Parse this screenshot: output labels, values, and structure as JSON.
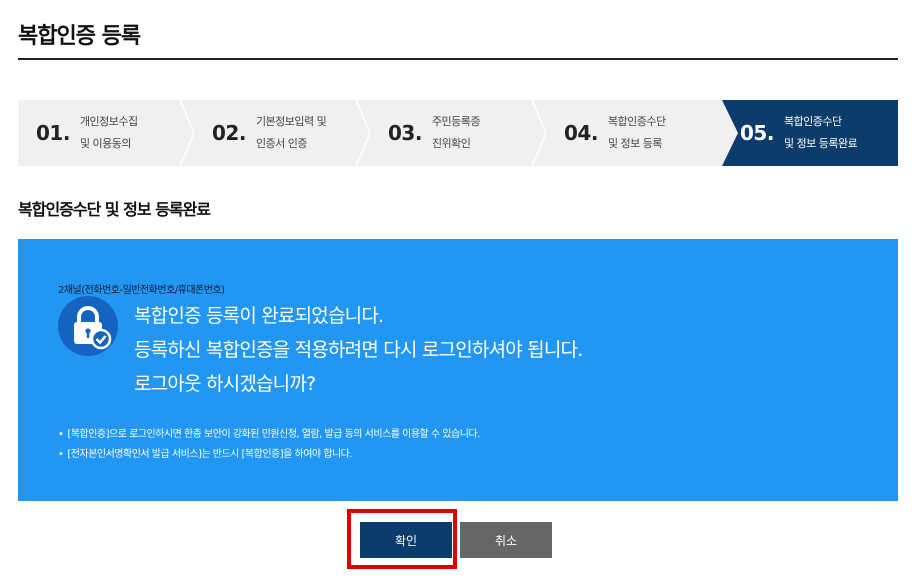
{
  "page": {
    "title": "복합인증 등록"
  },
  "steps": [
    {
      "num": "01.",
      "line1": "개인정보수집",
      "line2": "및 이용동의",
      "active": false
    },
    {
      "num": "02.",
      "line1": "기본정보입력 및",
      "line2": "인증서 인증",
      "active": false
    },
    {
      "num": "03.",
      "line1": "주민등록증",
      "line2": "진위확인",
      "active": false
    },
    {
      "num": "04.",
      "line1": "복합인증수단",
      "line2": "및 정보 등록",
      "active": false
    },
    {
      "num": "05.",
      "line1": "복합인증수단",
      "line2": "및 정보 등록완료",
      "active": true
    }
  ],
  "section": {
    "title": "복합인증수단 및 정보 등록완료"
  },
  "panel": {
    "channel_label": "2채널(전화번호-일반전화번호/휴대폰번호)",
    "messages": [
      "복합인증 등록이 완료되었습니다.",
      "등록하신 복합인증을 적용하려면 다시 로그인하셔야 됩니다.",
      "로그아웃 하시겠습니까?"
    ],
    "notes": [
      "[복합인증]으로 로그인하시면 한층 보안이 강화된 민원신청, 열람, 발급 등의 서비스를 이용할 수 있습니다.",
      "[전자본인서명확인서 발급 서비스]는 반드시 [복합인증]을 하여야 합니다."
    ],
    "icon": "lock-check-icon"
  },
  "buttons": {
    "ok_label": "확인",
    "cancel_label": "취소"
  },
  "colors": {
    "active_step": "#0b3c6b",
    "panel": "#2196f3",
    "icon_circle": "#1565c0",
    "cancel": "#666666",
    "highlight": "#e00000"
  }
}
